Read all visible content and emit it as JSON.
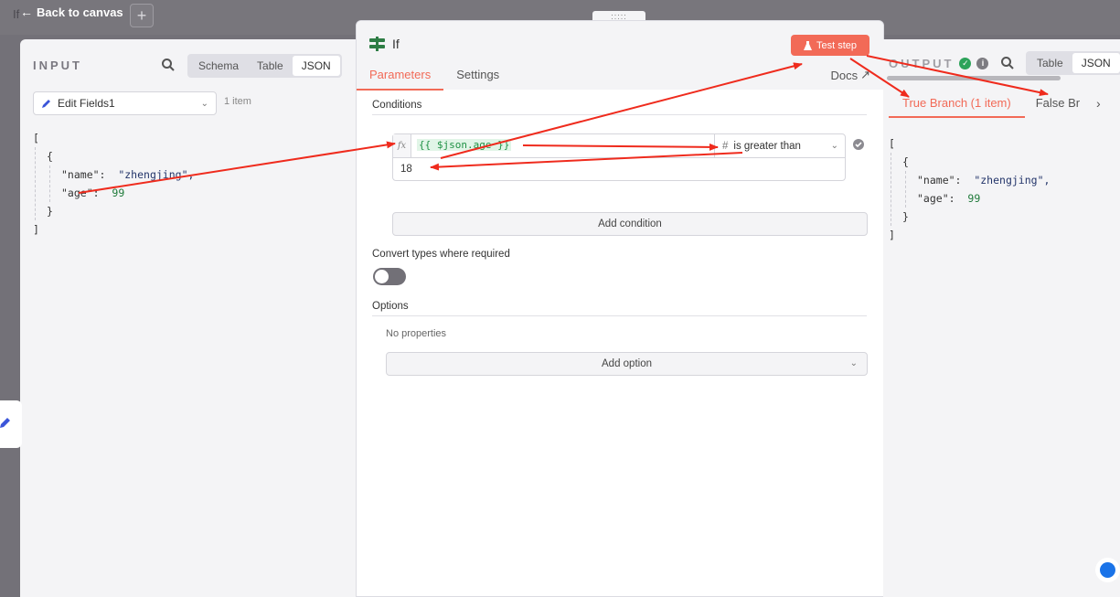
{
  "topbar": {
    "back_label": "Back to canvas",
    "ghost_title": "If",
    "add_label": "+"
  },
  "input": {
    "heading": "INPUT",
    "view_tabs": [
      "Schema",
      "Table",
      "JSON"
    ],
    "active_view": "JSON",
    "source_node": "Edit Fields1",
    "item_count": "1 item",
    "json": {
      "open": "[",
      "obj_open": "{",
      "name_key": "\"name\":",
      "name_val": "\"zhengjing\",",
      "age_key": "\"age\":",
      "age_val": "99",
      "obj_close": "}",
      "close": "]"
    }
  },
  "node": {
    "title": "If",
    "test_button": "Test step",
    "tabs": [
      "Parameters",
      "Settings"
    ],
    "active_tab": "Parameters",
    "docs_label": "Docs",
    "conditions_label": "Conditions",
    "condition": {
      "left_value": "{{ $json.age }}",
      "fx_label": "fx",
      "operator": "is greater than",
      "right_value": "18"
    },
    "add_condition_label": "Add condition",
    "convert_types_label": "Convert types where required",
    "convert_types_on": false,
    "options_label": "Options",
    "no_properties": "No properties",
    "add_option_label": "Add option"
  },
  "output": {
    "heading": "OUTPUT",
    "view_tabs": [
      "Table",
      "JSON"
    ],
    "active_view": "JSON",
    "branches": [
      "True Branch (1 item)",
      "False Br"
    ],
    "active_branch": "True Branch (1 item)",
    "json": {
      "open": "[",
      "obj_open": "{",
      "name_key": "\"name\":",
      "name_val": "\"zhengjing\",",
      "age_key": "\"age\":",
      "age_val": "99",
      "obj_close": "}",
      "close": "]"
    }
  },
  "colors": {
    "accent": "#f26a57",
    "success": "#2da35a",
    "expression_bg": "#e1f5e7",
    "annotation_arrow": "#ef2b1d"
  }
}
